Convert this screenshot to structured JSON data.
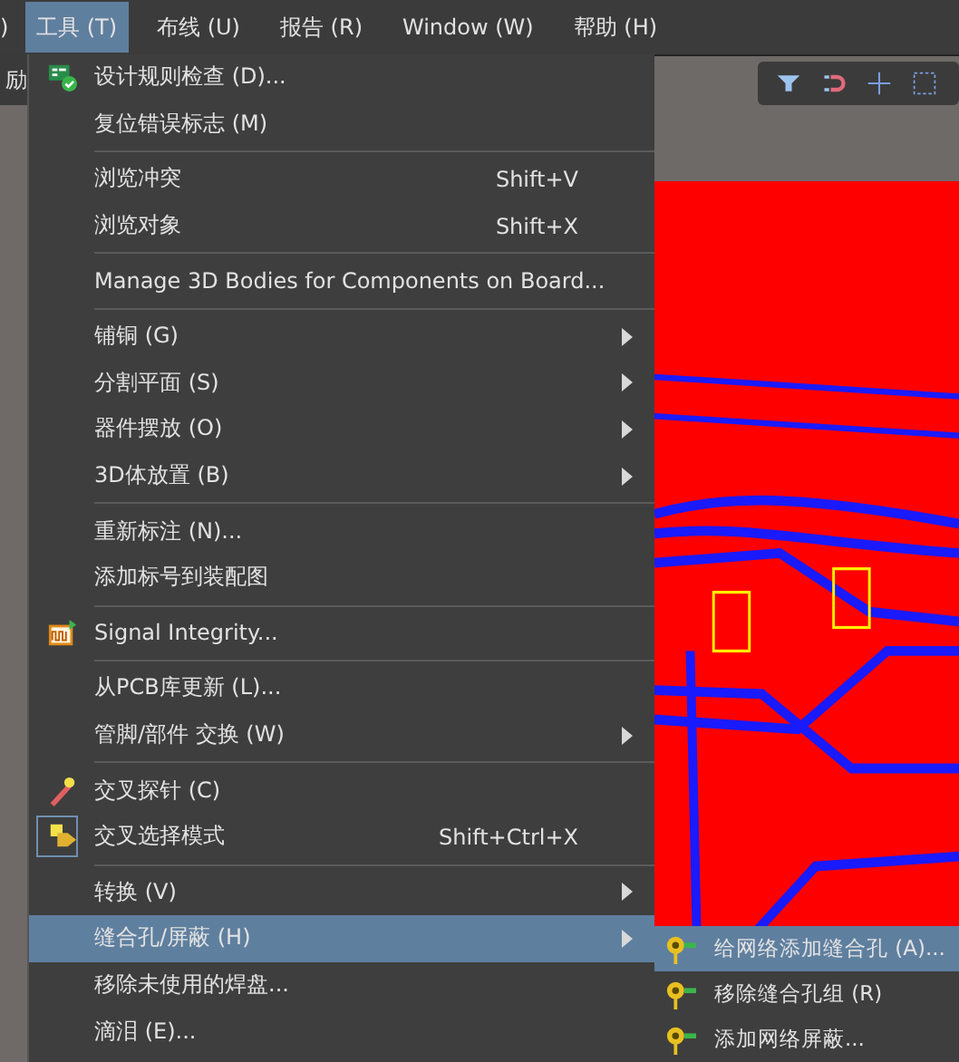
{
  "menubar": {
    "cut_left": ")",
    "items": [
      {
        "label": "工具 (T)",
        "selected": true
      },
      {
        "label": "布线 (U)",
        "selected": false
      },
      {
        "label": "报告 (R)",
        "selected": false
      },
      {
        "label": "Window (W)",
        "selected": false
      },
      {
        "label": "帮助 (H)",
        "selected": false
      }
    ]
  },
  "left_strip": {
    "text": "励"
  },
  "menu": {
    "items": [
      {
        "kind": "item",
        "label": "设计规则检查 (D)...",
        "selected": false,
        "checked": false,
        "submenu": false
      },
      {
        "kind": "item",
        "label": "复位错误标志 (M)",
        "selected": false,
        "checked": false,
        "submenu": false
      },
      {
        "kind": "separator"
      },
      {
        "kind": "item",
        "label": "浏览冲突",
        "shortcut": "Shift+V",
        "selected": false,
        "checked": false,
        "submenu": false
      },
      {
        "kind": "item",
        "label": "浏览对象",
        "shortcut": "Shift+X",
        "selected": false,
        "checked": false,
        "submenu": false
      },
      {
        "kind": "separator"
      },
      {
        "kind": "item",
        "label": "Manage 3D Bodies for Components on Board...",
        "selected": false,
        "checked": false,
        "submenu": false
      },
      {
        "kind": "separator"
      },
      {
        "kind": "item",
        "label": "铺铜 (G)",
        "selected": false,
        "checked": false,
        "submenu": true
      },
      {
        "kind": "item",
        "label": "分割平面 (S)",
        "selected": false,
        "checked": false,
        "submenu": true
      },
      {
        "kind": "item",
        "label": "器件摆放 (O)",
        "selected": false,
        "checked": false,
        "submenu": true
      },
      {
        "kind": "item",
        "label": "3D体放置 (B)",
        "selected": false,
        "checked": false,
        "submenu": true
      },
      {
        "kind": "separator"
      },
      {
        "kind": "item",
        "label": "重新标注 (N)...",
        "selected": false,
        "checked": false,
        "submenu": false
      },
      {
        "kind": "item",
        "label": "添加标号到装配图",
        "selected": false,
        "checked": false,
        "submenu": false
      },
      {
        "kind": "separator"
      },
      {
        "kind": "item",
        "label": "Signal Integrity...",
        "selected": false,
        "checked": false,
        "submenu": false
      },
      {
        "kind": "separator"
      },
      {
        "kind": "item",
        "label": "从PCB库更新 (L)...",
        "selected": false,
        "checked": false,
        "submenu": false
      },
      {
        "kind": "item",
        "label": "管脚/部件 交换 (W)",
        "selected": false,
        "checked": false,
        "submenu": true
      },
      {
        "kind": "separator"
      },
      {
        "kind": "item",
        "label": "交叉探针 (C)",
        "selected": false,
        "checked": false,
        "submenu": false
      },
      {
        "kind": "item",
        "label": "交叉选择模式",
        "shortcut": "Shift+Ctrl+X",
        "selected": false,
        "checked": true,
        "submenu": false
      },
      {
        "kind": "separator"
      },
      {
        "kind": "item",
        "label": "转换 (V)",
        "selected": false,
        "checked": false,
        "submenu": true
      },
      {
        "kind": "item",
        "label": "缝合孔/屏蔽 (H)",
        "selected": true,
        "checked": false,
        "submenu": true
      },
      {
        "kind": "item",
        "label": "移除未使用的焊盘...",
        "selected": false,
        "checked": false,
        "submenu": false
      },
      {
        "kind": "item",
        "label": "滴泪 (E)...",
        "selected": false,
        "checked": false,
        "submenu": false
      }
    ]
  },
  "submenu": {
    "items": [
      {
        "label": "给网络添加缝合孔 (A)...",
        "selected": true
      },
      {
        "label": "移除缝合孔组 (R)",
        "selected": false
      },
      {
        "label": "添加网络屏蔽...",
        "selected": false
      }
    ]
  }
}
